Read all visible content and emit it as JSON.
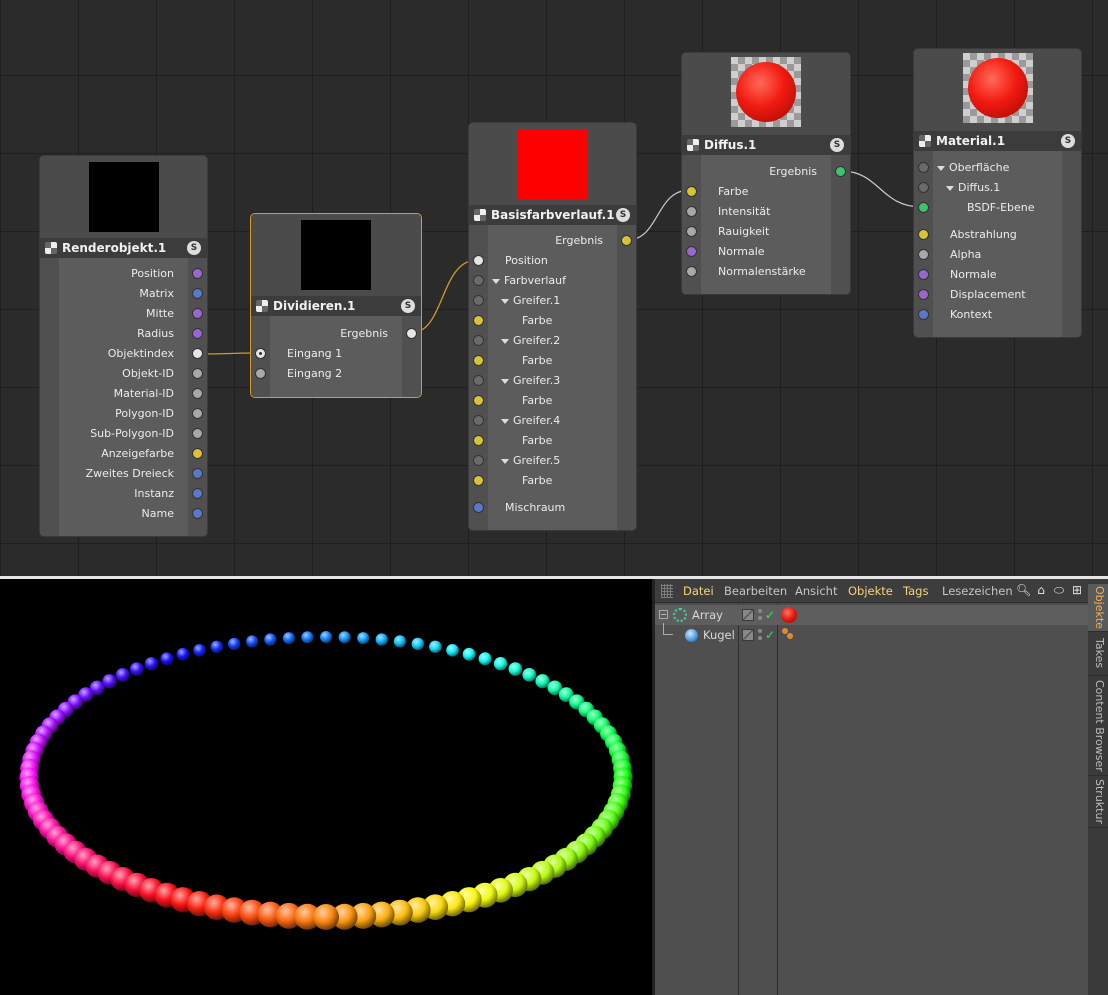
{
  "nodes": {
    "renderobjekt": {
      "title": "Renderobjekt.1",
      "s_label": "S",
      "ports": [
        "Position",
        "Matrix",
        "Mitte",
        "Radius",
        "Objektindex",
        "Objekt-ID",
        "Material-ID",
        "Polygon-ID",
        "Sub-Polygon-ID",
        "Anzeigefarbe",
        "Zweites Dreieck",
        "Instanz",
        "Name"
      ],
      "preview_color": "#000000"
    },
    "dividieren": {
      "title": "Dividieren.1",
      "s_label": "S",
      "output": "Ergebnis",
      "inputs": [
        "Eingang 1",
        "Eingang 2"
      ],
      "preview_color": "#000000"
    },
    "basisfarbverlauf": {
      "title": "Basisfarbverlauf.1",
      "s_label": "S",
      "output": "Ergebnis",
      "rows": [
        "Position",
        "Farbverlauf",
        "Greifer.1",
        "Farbe",
        "Greifer.2",
        "Farbe",
        "Greifer.3",
        "Farbe",
        "Greifer.4",
        "Farbe",
        "Greifer.5",
        "Farbe",
        "Mischraum"
      ],
      "preview_color": "#ff0000"
    },
    "diffus": {
      "title": "Diffus.1",
      "s_label": "S",
      "output": "Ergebnis",
      "inputs": [
        "Farbe",
        "Intensität",
        "Rauigkeit",
        "Normale",
        "Normalenstärke"
      ]
    },
    "material": {
      "title": "Material.1",
      "s_label": "S",
      "tree": [
        "Oberfläche",
        "Diffus.1",
        "BSDF-Ebene"
      ],
      "inputs": [
        "Abstrahlung",
        "Alpha",
        "Normale",
        "Displacement",
        "Kontext"
      ]
    }
  },
  "object_manager": {
    "menu": [
      "Datei",
      "Bearbeiten",
      "Ansicht",
      "Objekte",
      "Tags",
      "Lesezeichen"
    ],
    "objects": [
      {
        "name": "Array",
        "check": "✓"
      },
      {
        "name": "Kugel",
        "check": "✓"
      }
    ],
    "side_tabs": [
      "Objekte",
      "Takes",
      "Content Browser",
      "Struktur"
    ]
  },
  "colors": {
    "accent": "#d49a2a",
    "menu_highlight": "#f1d77a",
    "active_tab": "#f0b348"
  }
}
